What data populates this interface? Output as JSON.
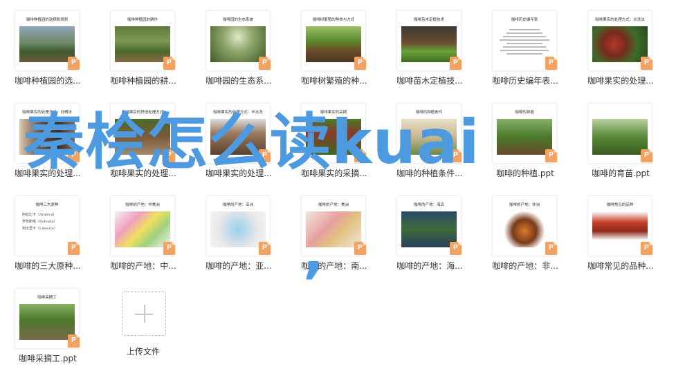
{
  "files": [
    {
      "slide_title": "咖啡种植园的选择和规划",
      "name": "咖啡种植园的选...",
      "scene": "estate"
    },
    {
      "slide_title": "咖啡种植园的耕作",
      "name": "咖啡种植园的耕...",
      "scene": "farm"
    },
    {
      "slide_title": "咖啡园的生态系统",
      "name": "咖啡园的生态系...",
      "scene": "forest"
    },
    {
      "slide_title": "咖啡树繁殖的种类与方式",
      "name": "咖啡树繁殖的种...",
      "scene": "seedlings"
    },
    {
      "slide_title": "咖啡苗木定植技术",
      "name": "咖啡苗木定植技...",
      "scene": "nursery"
    },
    {
      "slide_title": "咖啡历史编年表",
      "name": "咖啡历史编年表...",
      "scene": "doc"
    },
    {
      "slide_title": "咖啡果实的处理方式：水洗法",
      "name": "咖啡果实的处理...",
      "scene": "cherries"
    },
    {
      "slide_title": "咖啡果实的处理方式：日晒法",
      "name": "咖啡果实的处理...",
      "scene": "beans"
    },
    {
      "slide_title": "咖啡果实的其他处理方式",
      "name": "咖啡果实的处理...",
      "scene": "drying"
    },
    {
      "slide_title": "咖啡果实的处理方式：半水洗",
      "name": "咖啡果实的处理...",
      "scene": "beds"
    },
    {
      "slide_title": "咖啡果实的采摘",
      "name": "咖啡果实的采摘...",
      "scene": "picking"
    },
    {
      "slide_title": "咖啡的种植条件",
      "name": "咖啡的种植条件...",
      "scene": "worldmap"
    },
    {
      "slide_title": "咖啡的种植",
      "name": "咖啡的种植.ppt",
      "scene": "sprout"
    },
    {
      "slide_title": "",
      "name": "咖啡的育苗.ppt",
      "scene": "sapling"
    },
    {
      "slide_title": "咖啡三大原种",
      "name": "咖啡的三大原种...",
      "scene": "list"
    },
    {
      "slide_title": "咖啡的产地：中美洲",
      "name": "咖啡的产地：中...",
      "scene": "centralmap"
    },
    {
      "slide_title": "咖啡的产地：亚洲",
      "name": "咖啡的产地：亚...",
      "scene": "asiamap"
    },
    {
      "slide_title": "咖啡的产地：美洲",
      "name": "咖啡的产地：南...",
      "scene": "americamap"
    },
    {
      "slide_title": "咖啡的产地：海岛",
      "name": "咖啡的产地：海...",
      "scene": "islandmap"
    },
    {
      "slide_title": "咖啡的产地：非洲",
      "name": "咖啡的产地：非...",
      "scene": "africa"
    },
    {
      "slide_title": "咖啡常见的品种",
      "name": "咖啡常见的品种...",
      "scene": "varieties"
    },
    {
      "slide_title": "咖啡采摘工",
      "name": "咖啡采摘工.ppt",
      "scene": "workers"
    }
  ],
  "badge_letter": "P",
  "list_slide_lines": [
    "阿拉比卡（Arabica）",
    "罗布斯塔（Robusta）",
    "利比里卡（Liberica）"
  ],
  "upload": {
    "label": "上传文件"
  },
  "watermark": {
    "text": "秦桧怎么读kuai",
    "comma": ","
  },
  "colors": {
    "badge": "#f4a261",
    "watermark": "#4d9ae0"
  }
}
